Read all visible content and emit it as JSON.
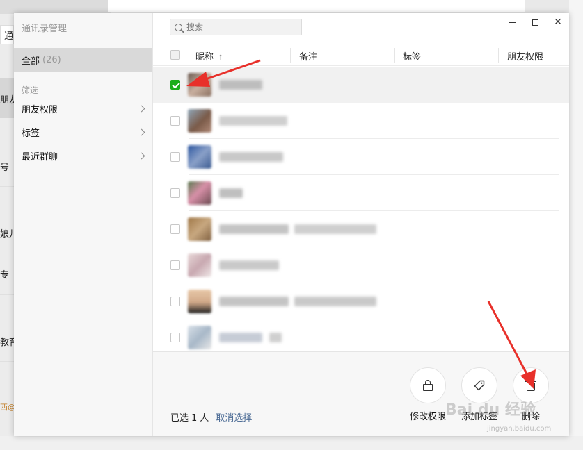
{
  "background": {
    "fragments": [
      "通",
      "朋友",
      "号",
      "娘儿",
      "专",
      "教育",
      "西@"
    ]
  },
  "window": {
    "title": "通讯录管理",
    "controls": {
      "minimize": "—",
      "maximize": "□",
      "close": "✕"
    }
  },
  "sidebar": {
    "all": {
      "label": "全部",
      "count": "(26)"
    },
    "filter_title": "筛选",
    "filters": [
      {
        "label": "朋友权限"
      },
      {
        "label": "标签"
      },
      {
        "label": "最近群聊"
      }
    ]
  },
  "search": {
    "placeholder": "搜索",
    "value": ""
  },
  "table": {
    "columns": {
      "nickname": "昵称",
      "sort_indicator": "↑",
      "remark": "备注",
      "tag": "标签",
      "permission": "朋友权限"
    },
    "rows": [
      {
        "checked": true
      },
      {
        "checked": false
      },
      {
        "checked": false
      },
      {
        "checked": false
      },
      {
        "checked": false
      },
      {
        "checked": false
      },
      {
        "checked": false
      },
      {
        "checked": false
      }
    ]
  },
  "footer": {
    "selected_prefix": "已选",
    "selected_count": "1",
    "selected_unit": "人",
    "cancel_selection": "取消选择",
    "actions": [
      {
        "label": "修改权限",
        "icon": "lock-icon"
      },
      {
        "label": "添加标签",
        "icon": "tag-icon"
      },
      {
        "label": "删除",
        "icon": "trash-icon"
      }
    ]
  },
  "watermark": {
    "main": "Bai du 经验",
    "sub": "jingyan.baidu.com"
  },
  "colors": {
    "accent": "#1aad19",
    "link": "#4a6a94",
    "annotation": "#e8302a"
  }
}
